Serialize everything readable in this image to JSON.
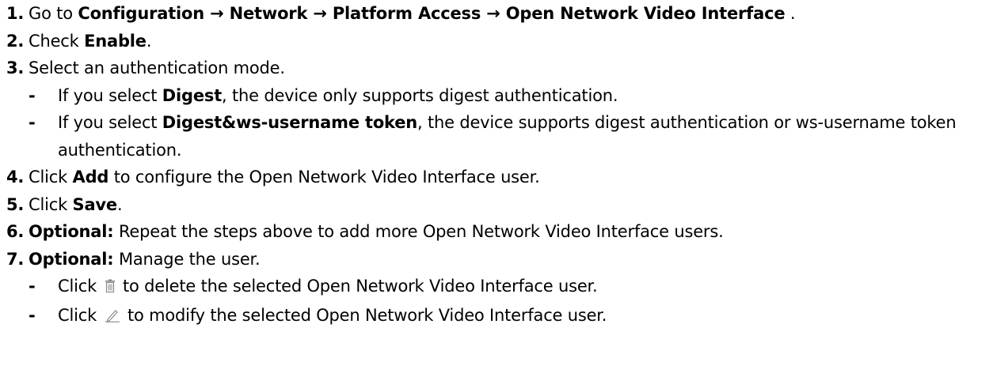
{
  "steps": [
    {
      "num": "1.",
      "pre": "Go to ",
      "path": "Configuration → Network → Platform Access → Open Network Video Interface",
      "post": " ."
    },
    {
      "num": "2.",
      "pre": "Check ",
      "bold": "Enable",
      "post": "."
    },
    {
      "num": "3.",
      "text": "Select an authentication mode.",
      "subs": [
        {
          "pre": "If you select ",
          "bold": "Digest",
          "post": ", the device only supports digest authentication."
        },
        {
          "pre": "If you select ",
          "bold": "Digest&ws-username token",
          "post": ", the device supports digest authentication or ws-username token authentication."
        }
      ]
    },
    {
      "num": "4.",
      "pre": "Click ",
      "bold": "Add",
      "post": " to configure the Open Network Video Interface user."
    },
    {
      "num": "5.",
      "pre": "Click ",
      "bold": "Save",
      "post": "."
    },
    {
      "num": "6.",
      "label": "Optional:",
      "post": " Repeat the steps above to add more Open Network Video Interface users."
    },
    {
      "num": "7.",
      "label": "Optional:",
      "post": " Manage the user.",
      "subs": [
        {
          "pre": "Click ",
          "icon": "delete-icon",
          "post": " to delete the selected Open Network Video Interface user."
        },
        {
          "pre": "Click ",
          "icon": "edit-icon",
          "post": " to modify the selected Open Network Video Interface user."
        }
      ]
    }
  ],
  "dash": "-"
}
